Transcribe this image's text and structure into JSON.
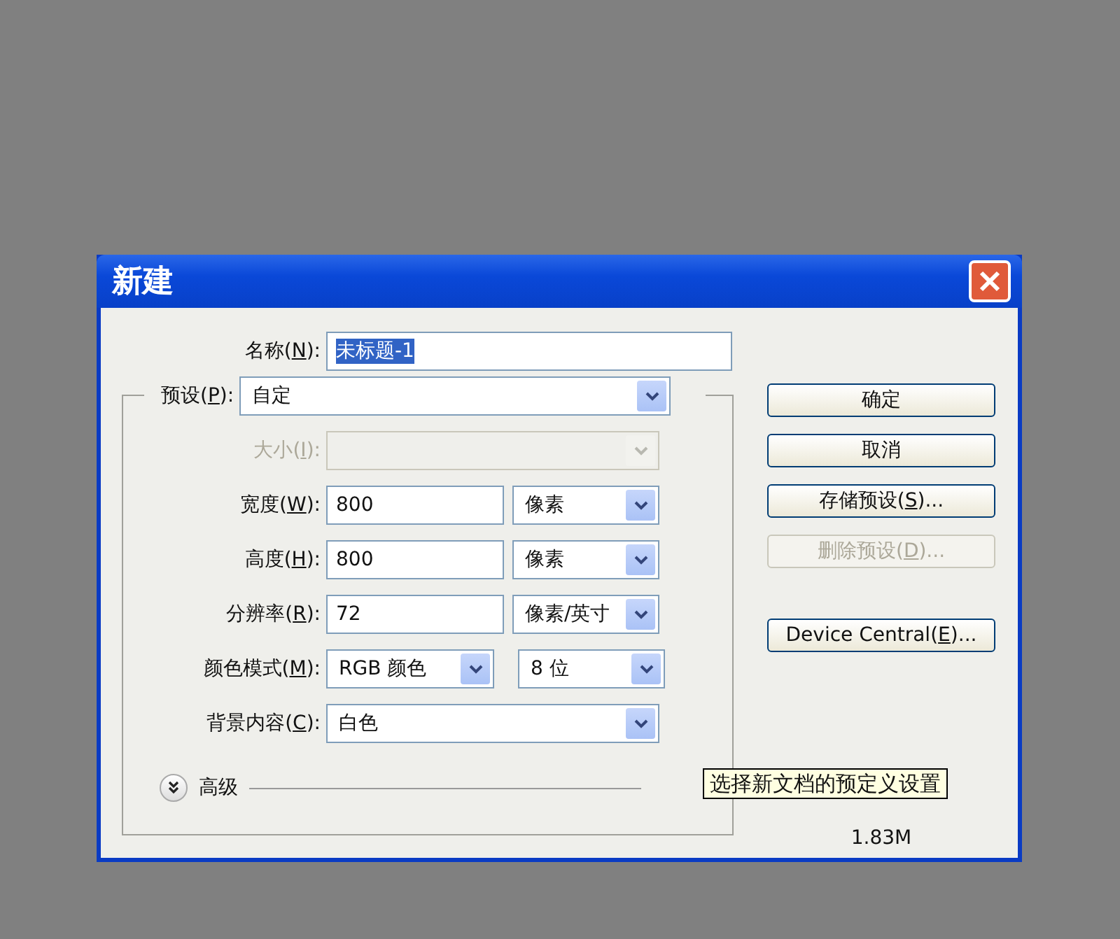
{
  "window": {
    "title": "新建"
  },
  "name_field": {
    "label_before": "名称(",
    "label_key": "N",
    "label_after": "):",
    "value": "未标题-1",
    "value_selected": true
  },
  "preset": {
    "label_before": "预设(",
    "label_key": "P",
    "label_after": "):",
    "value": "自定"
  },
  "rows": [
    {
      "kind": "select",
      "label_before": "大小(",
      "label_key": "I",
      "label_after": "):",
      "disabled": true
    },
    {
      "kind": "number",
      "label_before": "宽度(",
      "label_key": "W",
      "label_after": "):",
      "disabled": false,
      "value": "800",
      "unit": "像素"
    },
    {
      "kind": "number",
      "label_before": "高度(",
      "label_key": "H",
      "label_after": "):",
      "disabled": false,
      "value": "800",
      "unit": "像素"
    },
    {
      "kind": "number",
      "label_before": "分辨率(",
      "label_key": "R",
      "label_after": "):",
      "disabled": false,
      "value": "72",
      "unit": "像素/英寸"
    },
    {
      "kind": "pair",
      "label_before": "颜色模式(",
      "label_key": "M",
      "label_after": "):",
      "disabled": false,
      "value": "RGB 颜色",
      "unit": "8 位"
    },
    {
      "kind": "select",
      "label_before": "背景内容(",
      "label_key": "C",
      "label_after": "):",
      "disabled": false,
      "value": "白色"
    }
  ],
  "advanced": {
    "label": "高级",
    "expanded": false
  },
  "buttons": [
    {
      "label_before": "确定",
      "disabled": false
    },
    {
      "label_before": "取消",
      "disabled": false
    },
    {
      "label_before": "存储预设(",
      "label_key": "S",
      "label_after": ")...",
      "disabled": false
    },
    {
      "label_before": "删除预设(",
      "label_key": "D",
      "label_after": ")...",
      "disabled": true
    },
    {
      "label_before": "Device Central(",
      "label_key": "E",
      "label_after": ")...",
      "disabled": false
    }
  ],
  "image_size": {
    "value": "1.83M"
  },
  "tooltip": "选择新文档的预定义设置"
}
